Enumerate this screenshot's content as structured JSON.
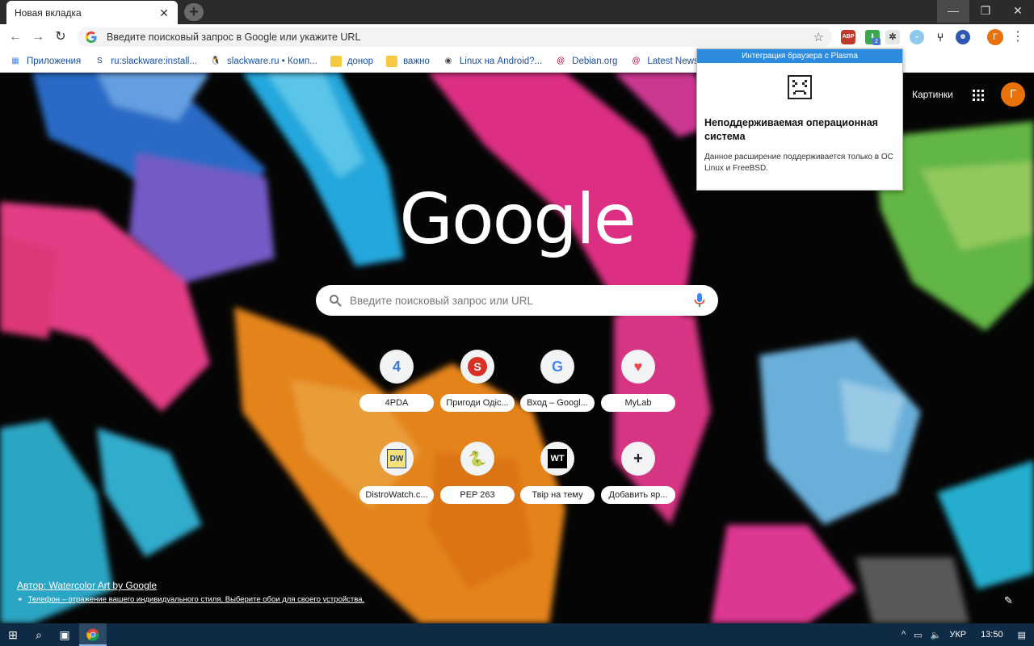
{
  "tab": {
    "title": "Новая вкладка",
    "close": "✕",
    "new": "+"
  },
  "window": {
    "minimize": "—",
    "maximize": "❐",
    "close": "✕"
  },
  "omnibox": {
    "placeholder": "Введите поисковый запрос в Google или укажите URL",
    "star": "☆"
  },
  "toolbar": {
    "back": "←",
    "forward": "→",
    "reload": "↻",
    "avatar_letter": "Г",
    "menu": "⋮",
    "extensions": [
      {
        "name": "abp",
        "label": "ABP"
      },
      {
        "name": "green-extension",
        "badge": "2"
      },
      {
        "name": "plasma-integration"
      },
      {
        "name": "blue-extension"
      },
      {
        "name": "fork-extension"
      },
      {
        "name": "globe-extension"
      }
    ]
  },
  "bookmarks": [
    {
      "label": "Приложения",
      "icon": "apps-grid-icon",
      "color": "#4285f4"
    },
    {
      "label": "ru:slackware:install...",
      "icon": "slackware-icon",
      "color": "#1a3a8a"
    },
    {
      "label": "slackware.ru • Комп...",
      "icon": "penguin-icon",
      "color": "#222222"
    },
    {
      "label": "донор",
      "icon": "folder-icon",
      "color": "#f6c945"
    },
    {
      "label": "важно",
      "icon": "folder-icon",
      "color": "#f6c945"
    },
    {
      "label": "Linux на Android?...",
      "icon": "globe-icon",
      "color": "#444444"
    },
    {
      "label": "Debian.org",
      "icon": "debian-icon",
      "color": "#c70036"
    },
    {
      "label": "Latest News",
      "icon": "debian-icon",
      "color": "#c70036"
    },
    {
      "label": "",
      "icon": "debian-icon",
      "color": "#c70036"
    }
  ],
  "popup": {
    "header": "Интеграция браузера с Plasma",
    "title": "Неподдерживаемая операционная система",
    "description": "Данное расширение поддерживается только в ОС Linux и FreeBSD."
  },
  "ntp": {
    "images_link": "Картинки",
    "avatar_letter": "Г",
    "logo": "Google",
    "search_placeholder": "Введите поисковый запрос или URL",
    "attribution": "Автор: Watercolor Art by Google",
    "attribution_link_icon": "⚭",
    "attribution_link": "Телефон – отражение вашего индивидуального стиля. Выберите обои для своего устройства.",
    "edit": "✎"
  },
  "shortcuts": [
    {
      "label": "4PDA",
      "icon": "4pda-icon",
      "glyph": "4",
      "color": "#3c7bd6"
    },
    {
      "label": "Пригоди Одіс...",
      "icon": "s-icon",
      "glyph": "S",
      "color": "#d93025"
    },
    {
      "label": "Вход – Googl...",
      "icon": "google-g-icon",
      "glyph": "G",
      "color": "#4285f4"
    },
    {
      "label": "MyLab",
      "icon": "mylab-icon",
      "glyph": "♥",
      "color": "#e5484d"
    },
    {
      "label": "DistroWatch.c...",
      "icon": "dw-icon",
      "glyph": "DW",
      "color": "#1c3f8c"
    },
    {
      "label": "PEP 263",
      "icon": "python-icon",
      "glyph": "🐍",
      "color": "#3572a5"
    },
    {
      "label": "Твір на тему",
      "icon": "wt-icon",
      "glyph": "WT",
      "color": "#000000"
    },
    {
      "label": "Добавить яр...",
      "icon": "plus-icon",
      "glyph": "+",
      "color": "#202124"
    }
  ],
  "taskbar": {
    "start": "⊞",
    "search": "⌕",
    "tasks": "▣",
    "tray": {
      "chevron": "^",
      "network": "▭",
      "volume": "🔈",
      "lang": "УКР",
      "time": "13:50",
      "notify": "▤"
    }
  }
}
